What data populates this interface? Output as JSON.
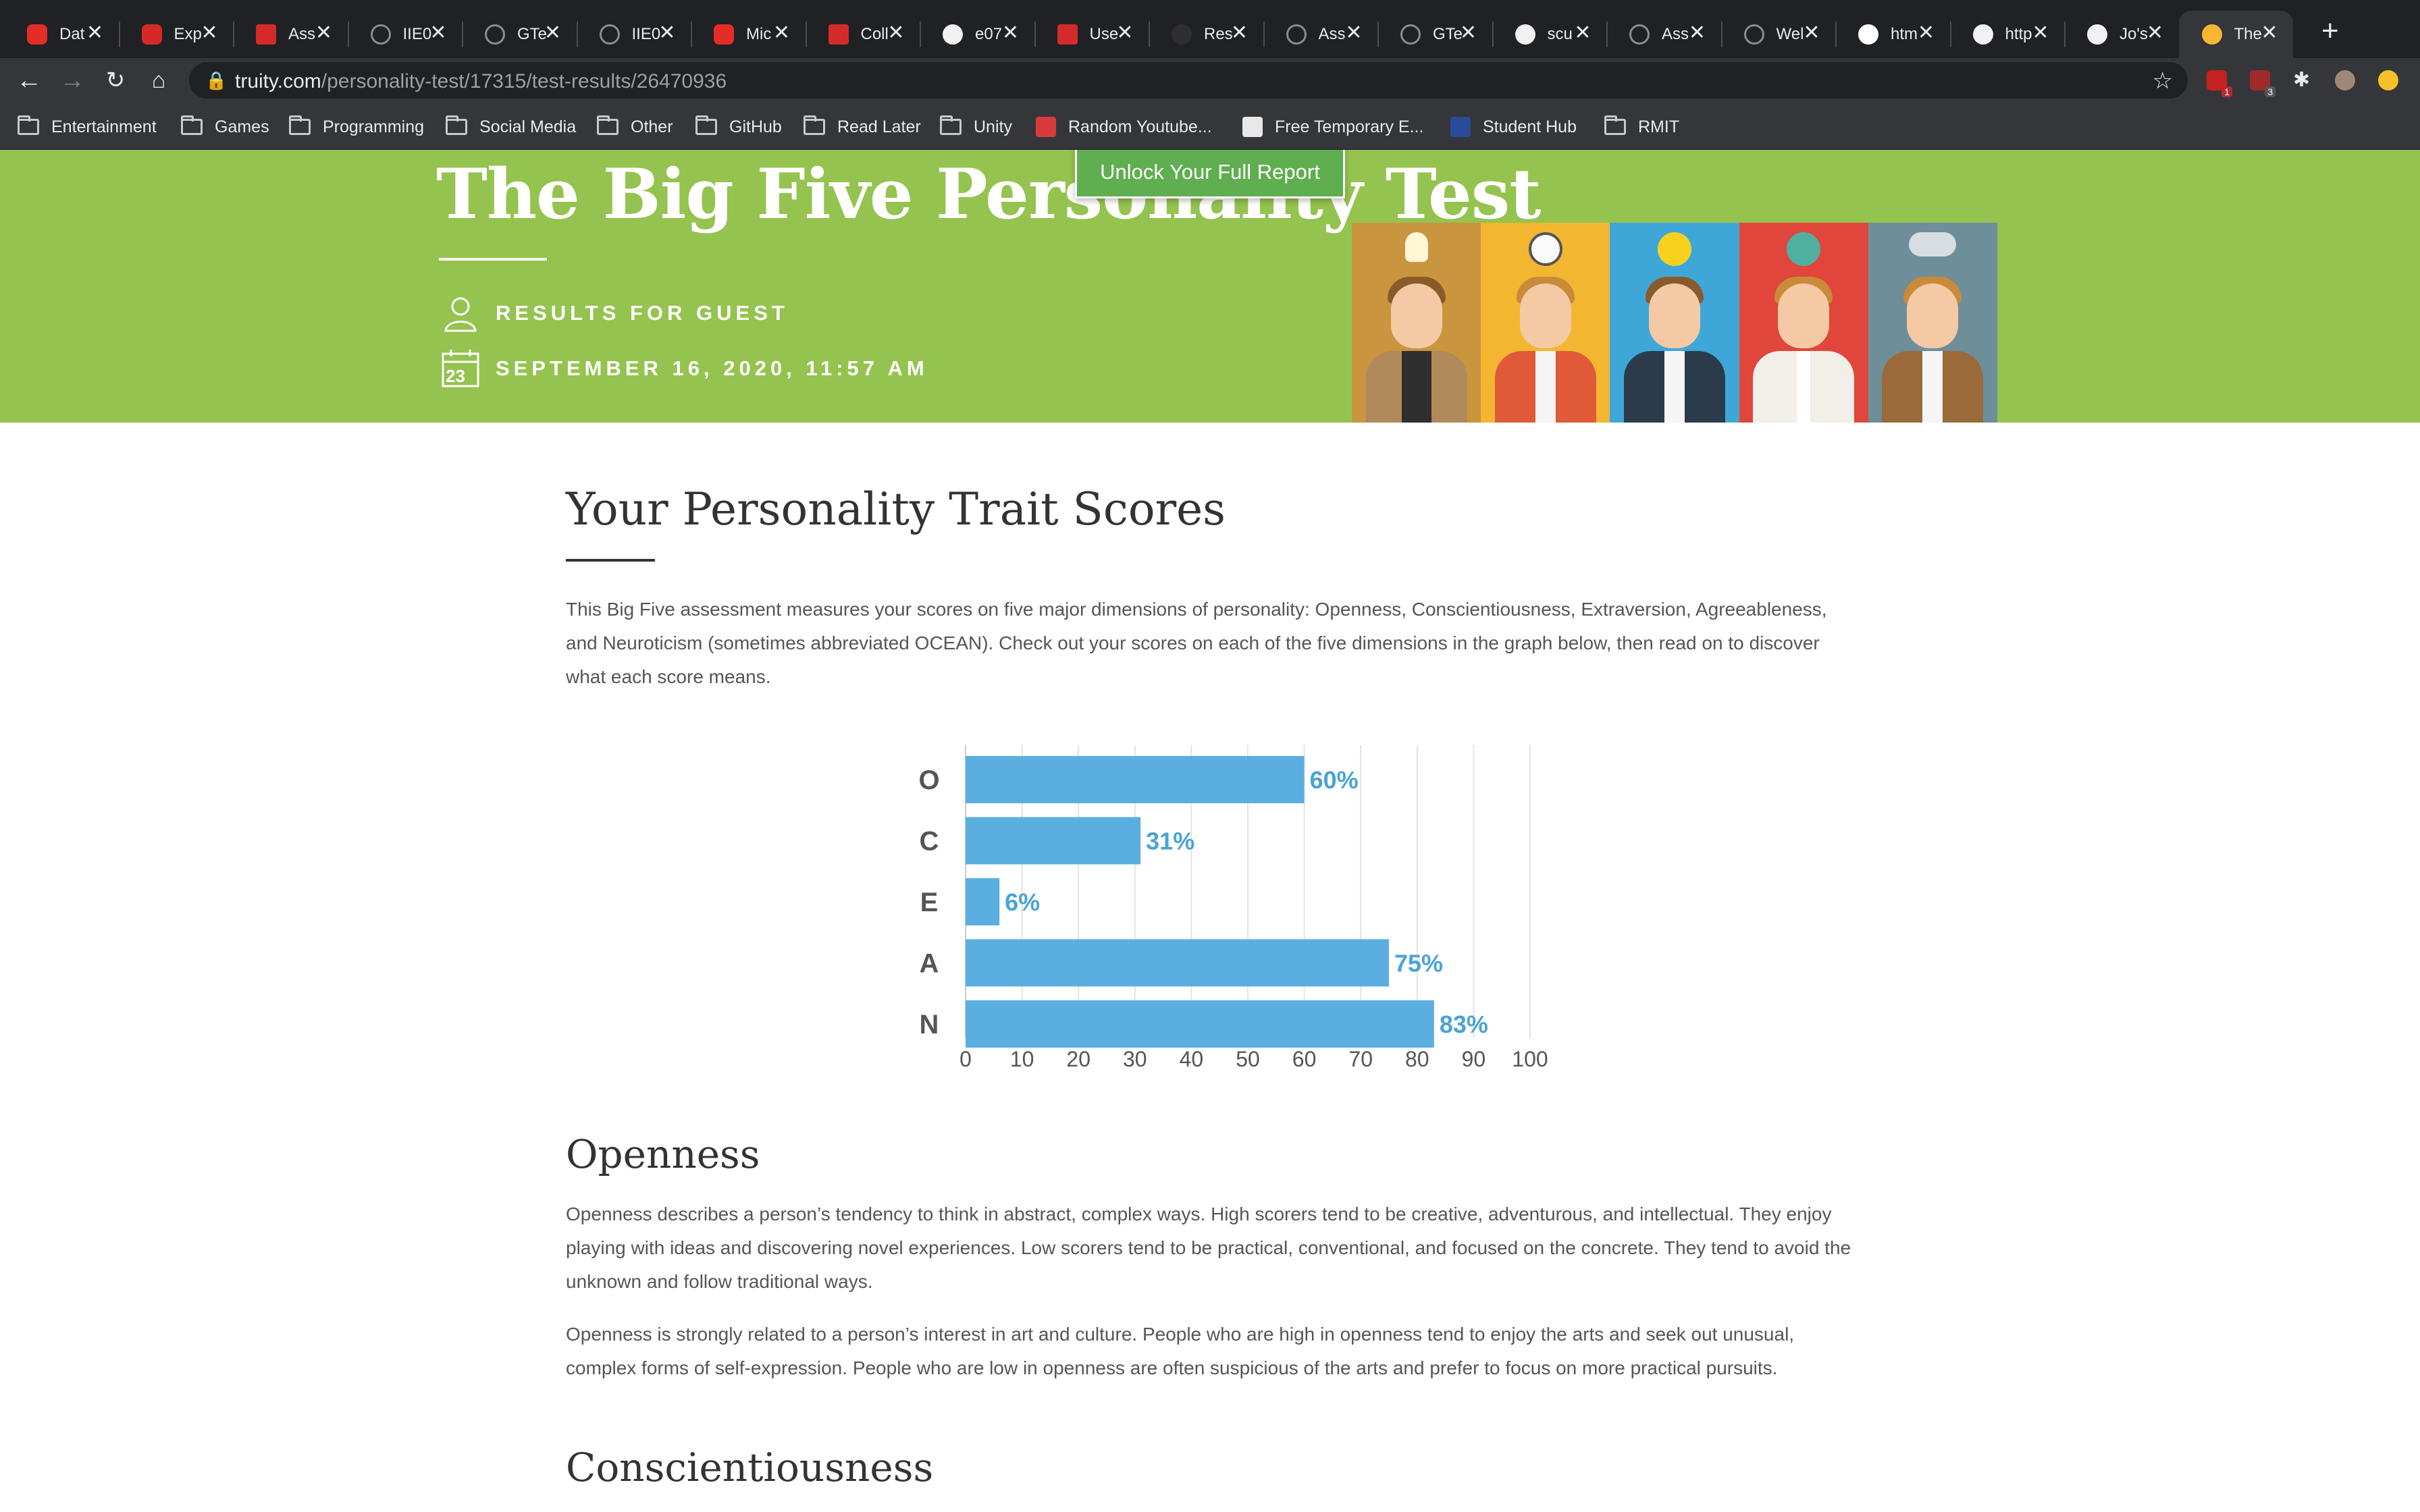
{
  "browser": {
    "tabs": [
      {
        "title": "Dat",
        "icon": "youtube-icon",
        "kind": "yt"
      },
      {
        "title": "Exp",
        "icon": "opera-icon",
        "kind": "opera"
      },
      {
        "title": "Ass",
        "icon": "app-icon",
        "kind": "redsq"
      },
      {
        "title": "IIE0",
        "icon": "globe-icon",
        "kind": "globe"
      },
      {
        "title": "GTe",
        "icon": "globe-icon",
        "kind": "globe"
      },
      {
        "title": "IIE0",
        "icon": "globe-icon",
        "kind": "globe"
      },
      {
        "title": "Mic",
        "icon": "youtube-icon",
        "kind": "yt"
      },
      {
        "title": "Coll",
        "icon": "app-icon",
        "kind": "redsq"
      },
      {
        "title": "e07",
        "icon": "github-icon",
        "kind": "gh"
      },
      {
        "title": "Use",
        "icon": "app-icon",
        "kind": "redsq"
      },
      {
        "title": "Res",
        "icon": "dark-circle-icon",
        "kind": "dark"
      },
      {
        "title": "Ass",
        "icon": "globe-icon",
        "kind": "globe"
      },
      {
        "title": "GTe",
        "icon": "globe-icon",
        "kind": "globe"
      },
      {
        "title": "scu",
        "icon": "github-icon",
        "kind": "gh"
      },
      {
        "title": "Ass",
        "icon": "globe-icon",
        "kind": "globe"
      },
      {
        "title": "Wel",
        "icon": "globe-icon",
        "kind": "globe"
      },
      {
        "title": "htm",
        "icon": "google-icon",
        "kind": "gg"
      },
      {
        "title": "http",
        "icon": "globe-icon",
        "kind": "gh"
      },
      {
        "title": "Jo's",
        "icon": "globe-icon",
        "kind": "gh"
      },
      {
        "title": "The",
        "icon": "truity-icon",
        "kind": "truity",
        "active": true
      }
    ],
    "url_host": "truity.com",
    "url_path": "/personality-test/17315/test-results/26470936",
    "extension_badges": [
      "1",
      "3"
    ],
    "bookmarks": [
      {
        "label": "Entertainment",
        "icon": "folder-icon"
      },
      {
        "label": "Games",
        "icon": "folder-icon"
      },
      {
        "label": "Programming",
        "icon": "folder-icon"
      },
      {
        "label": "Social Media",
        "icon": "folder-icon"
      },
      {
        "label": "Other",
        "icon": "folder-icon"
      },
      {
        "label": "GitHub",
        "icon": "folder-icon"
      },
      {
        "label": "Read Later",
        "icon": "folder-icon"
      },
      {
        "label": "Unity",
        "icon": "folder-icon"
      },
      {
        "label": "Random Youtube...",
        "icon": "shuffle-icon"
      },
      {
        "label": "Free Temporary E...",
        "icon": "mail-icon"
      },
      {
        "label": "Student Hub",
        "icon": "student-hub-icon"
      },
      {
        "label": "RMIT",
        "icon": "folder-icon"
      }
    ]
  },
  "hero": {
    "title": "The Big Five Personality Test",
    "results_for": "RESULTS FOR GUEST",
    "calendar_day": "23",
    "date": "SEPTEMBER 16, 2020, 11:57 AM",
    "unlock_button": "Unlock Your Full Report",
    "colors": {
      "background": "#95c34f",
      "button": "#5fae4f"
    }
  },
  "content": {
    "heading": "Your Personality Trait Scores",
    "intro": "This Big Five assessment measures your scores on five major dimensions of personality: Openness, Conscientiousness, Extraversion, Agreeableness, and Neuroticism (sometimes abbreviated OCEAN). Check out your scores on each of the five dimensions in the graph below, then read on to discover what each score means.",
    "openness_heading": "Openness",
    "openness_p1": "Openness describes a person’s tendency to think in abstract, complex ways. High scorers tend to be creative, adventurous, and intellectual. They enjoy playing with ideas and discovering novel experiences. Low scorers tend to be practical, conventional, and focused on the concrete. They tend to avoid the unknown and follow traditional ways.",
    "openness_p2": "Openness is strongly related to a person’s interest in art and culture. People who are high in openness tend to enjoy the arts and seek out unusual, complex forms of self-expression. People who are low in openness are often suspicious of the arts and prefer to focus on more practical pursuits.",
    "conscientiousness_heading": "Conscientiousness"
  },
  "chart_data": {
    "type": "bar",
    "orientation": "horizontal",
    "categories": [
      "O",
      "C",
      "E",
      "A",
      "N"
    ],
    "values": [
      60,
      31,
      6,
      75,
      83
    ],
    "value_labels": [
      "60%",
      "31%",
      "6%",
      "75%",
      "83%"
    ],
    "xlim": [
      0,
      100
    ],
    "xticks": [
      0,
      10,
      20,
      30,
      40,
      50,
      60,
      70,
      80,
      90,
      100
    ],
    "grid": "vertical",
    "bar_color": "#5aafe0",
    "label_color": "#4aa3d6"
  }
}
